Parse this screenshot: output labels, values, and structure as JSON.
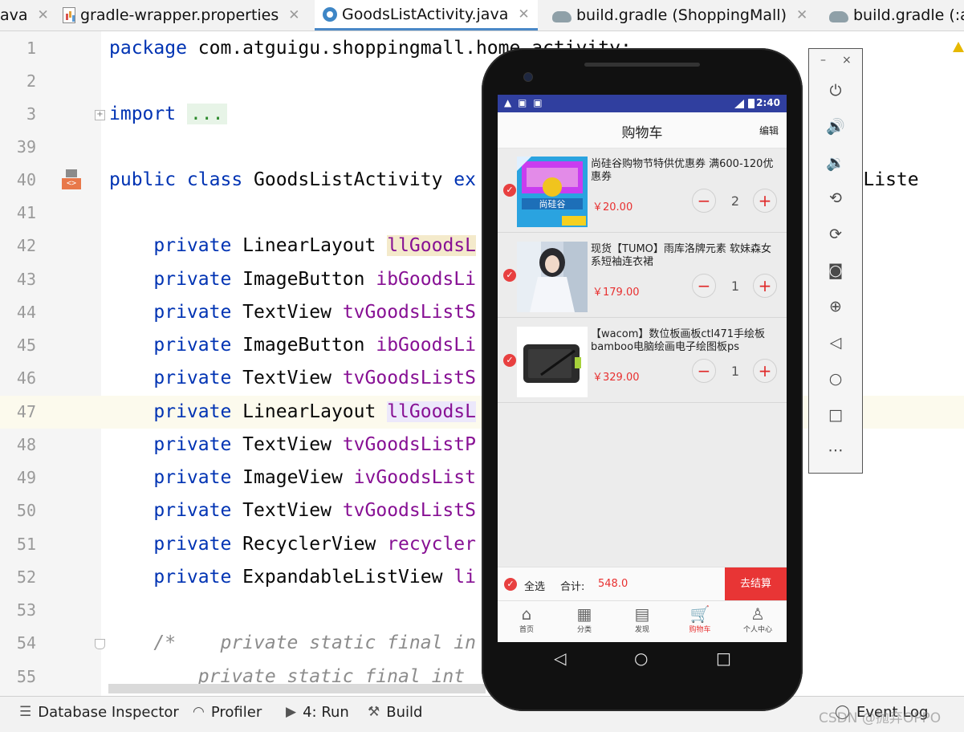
{
  "ide": {
    "tabs": [
      {
        "label": "ava"
      },
      {
        "label": "gradle-wrapper.properties"
      },
      {
        "label": "GoodsListActivity.java",
        "active": true
      },
      {
        "label": "build.gradle (ShoppingMall)"
      },
      {
        "label": "build.gradle (:a"
      }
    ],
    "code_lines": [
      {
        "num": "1",
        "text": "package com.atguigu.shoppingmall.home.activity;"
      },
      {
        "num": "2",
        "text": ""
      },
      {
        "num": "3",
        "text": "import ..."
      },
      {
        "num": "39",
        "text": ""
      },
      {
        "num": "40",
        "text": "public class GoodsListActivity ex",
        "tail": "lickListe"
      },
      {
        "num": "41",
        "text": ""
      },
      {
        "num": "42",
        "text": "    private LinearLayout llGoodsL"
      },
      {
        "num": "43",
        "text": "    private ImageButton ibGoodsLi"
      },
      {
        "num": "44",
        "text": "    private TextView tvGoodsListS"
      },
      {
        "num": "45",
        "text": "    private ImageButton ibGoodsLi"
      },
      {
        "num": "46",
        "text": "    private TextView tvGoodsListS"
      },
      {
        "num": "47",
        "text": "    private LinearLayout llGoodsL"
      },
      {
        "num": "48",
        "text": "    private TextView tvGoodsListP"
      },
      {
        "num": "49",
        "text": "    private ImageView ivGoodsList"
      },
      {
        "num": "50",
        "text": "    private TextView tvGoodsListS"
      },
      {
        "num": "51",
        "text": "    private RecyclerView recycler"
      },
      {
        "num": "52",
        "text": "    private ExpandableListView li"
      },
      {
        "num": "53",
        "text": ""
      },
      {
        "num": "54",
        "text": "    /*    private static final in"
      },
      {
        "num": "55",
        "text": "        private static final int"
      }
    ],
    "bottom_tools": [
      {
        "label": "Database Inspector",
        "icon": "database-icon"
      },
      {
        "label": "Profiler",
        "icon": "gauge-icon"
      },
      {
        "label": "4: Run",
        "icon": "run-icon"
      },
      {
        "label": "Build",
        "icon": "hammer-icon"
      },
      {
        "label": "Event Log",
        "icon": "event-log-icon"
      }
    ],
    "watermark": "CSDN @抛弃OPPO"
  },
  "phone": {
    "status_time": "2:40",
    "appbar": {
      "title": "购物车",
      "edit": "编辑"
    },
    "items": [
      {
        "name": "尚硅谷购物节特供优惠券  满600-120优惠券",
        "price": "￥20.00",
        "qty": "2",
        "thumb": "coupon-image"
      },
      {
        "name": "现货【TUMO】雨库洛牌元素 软妹森女系短袖连衣裙",
        "price": "￥179.00",
        "qty": "1",
        "thumb": "dress-photo"
      },
      {
        "name": "【wacom】数位板画板ctl471手绘板bamboo电脑绘画电子绘图板ps",
        "price": "￥329.00",
        "qty": "1",
        "thumb": "tablet-photo"
      }
    ],
    "bottom": {
      "check_all": "全选",
      "total_label": "合计:",
      "total_value": "548.0",
      "checkout": "去结算"
    },
    "nav": [
      {
        "label": "首页",
        "icon": "home-icon",
        "glyph": "⌂"
      },
      {
        "label": "分类",
        "icon": "category-icon",
        "glyph": "▦"
      },
      {
        "label": "发现",
        "icon": "discover-icon",
        "glyph": "▤"
      },
      {
        "label": "购物车",
        "icon": "cart-icon",
        "glyph": "🛒",
        "active": true
      },
      {
        "label": "个人中心",
        "icon": "user-icon",
        "glyph": "♙"
      }
    ]
  },
  "emulator_panel": [
    "power-icon",
    "volume-up-icon",
    "volume-down-icon",
    "rotate-left-icon",
    "rotate-right-icon",
    "camera-icon",
    "zoom-icon",
    "back-icon",
    "home-icon",
    "overview-icon",
    "more-icon"
  ]
}
